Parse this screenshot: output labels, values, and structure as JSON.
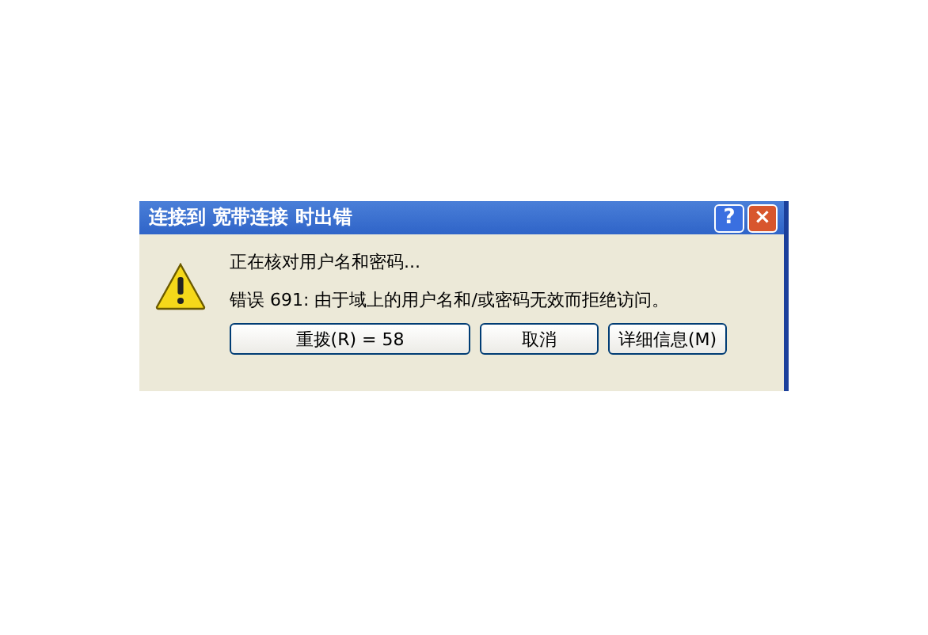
{
  "window": {
    "title": "连接到 宽带连接 时出错"
  },
  "title_buttons": [
    {
      "kind": "help",
      "label": "?"
    },
    {
      "kind": "close",
      "label": "×"
    }
  ],
  "messages": [
    "正在核对用户名和密码...",
    "错误 691: 由于域上的用户名和/或密码无效而拒绝访问。"
  ],
  "buttons": [
    {
      "label": "重拨(R) = 58",
      "kind": "wide"
    },
    {
      "label": "取消",
      "kind": "normal"
    },
    {
      "label": "详细信息(M)",
      "kind": "normal"
    }
  ]
}
